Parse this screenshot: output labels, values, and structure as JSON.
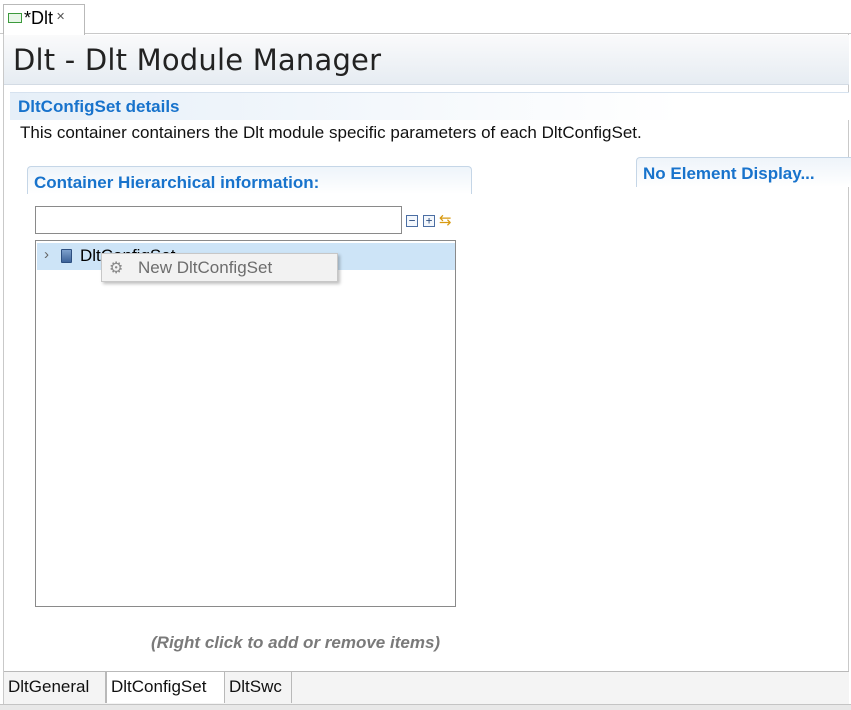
{
  "editor": {
    "tab_label": "*Dlt",
    "tab_icon": "module-file-icon",
    "close_icon": "close-icon"
  },
  "page": {
    "title": "Dlt - Dlt Module Manager"
  },
  "section": {
    "title": "DltConfigSet details",
    "description": "This container containers the Dlt module specific parameters of each DltConfigSet."
  },
  "hierarchy": {
    "title": "Container Hierarchical information:",
    "filter_value": "",
    "tools": [
      "collapse-all-icon",
      "expand-all-icon",
      "sync-icon"
    ],
    "tree_items": [
      {
        "label": "DltConfigSet",
        "icon": "container-icon",
        "expanded": false,
        "selected": true
      }
    ],
    "hint": "(Right click to add or remove items)"
  },
  "context_menu": {
    "items": [
      {
        "label": "New DltConfigSet",
        "icon": "gear-icon",
        "enabled": false
      }
    ]
  },
  "details": {
    "title": "No Element Display..."
  },
  "bottom_tabs": [
    {
      "label": "DltGeneral",
      "active": false
    },
    {
      "label": "DltConfigSet",
      "active": true
    },
    {
      "label": "DltSwc",
      "active": false
    }
  ],
  "colors": {
    "accent": "#1873cc",
    "selection": "#cde4f7",
    "hint": "#7a7a7a"
  }
}
